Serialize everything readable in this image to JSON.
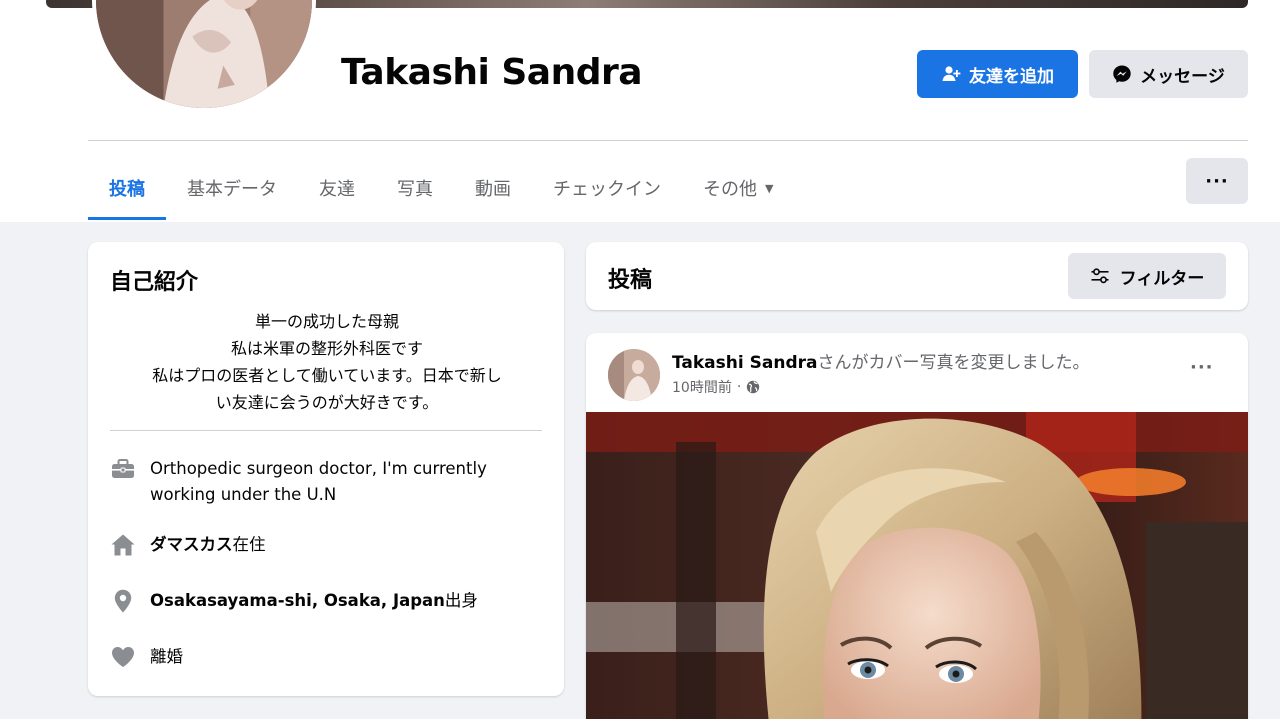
{
  "profile": {
    "name": "Takashi Sandra",
    "add_friend_label": "友達を追加",
    "message_label": "メッセージ"
  },
  "tabs": [
    {
      "label": "投稿",
      "active": true
    },
    {
      "label": "基本データ"
    },
    {
      "label": "友達"
    },
    {
      "label": "写真"
    },
    {
      "label": "動画"
    },
    {
      "label": "チェックイン"
    },
    {
      "label": "その他"
    }
  ],
  "more_label": "···",
  "intro": {
    "title": "自己紹介",
    "bio_lines": [
      "単一の成功した母親",
      "私は米軍の整形外科医です",
      "私はプロの医者として働いています。日本で新し",
      "い友達に会うのが大好きです。"
    ],
    "work": "Orthopedic surgeon doctor, I'm currently working under the U.N",
    "lives_in_place": "ダマスカス",
    "lives_in_suffix": "在住",
    "from_place": "Osakasayama-shi, Osaka, Japan",
    "from_suffix": "出身",
    "relationship": "離婚"
  },
  "posts_section": {
    "title": "投稿",
    "filter_label": "フィルター"
  },
  "post": {
    "author": "Takashi Sandra",
    "action": "さんがカバー写真を変更しました。",
    "time": "10時間前",
    "separator": "·",
    "more": "···"
  },
  "colors": {
    "accent": "#1b74e4",
    "page_bg": "#f0f2f5",
    "secondary_button": "#e4e6eb",
    "muted_text": "#65676b"
  },
  "icons": {
    "add_friend": "person-plus-icon",
    "message": "messenger-icon",
    "filter": "sliders-icon",
    "work": "briefcase-icon",
    "home": "house-icon",
    "location": "map-pin-icon",
    "relationship": "heart-icon",
    "privacy": "globe-icon"
  }
}
